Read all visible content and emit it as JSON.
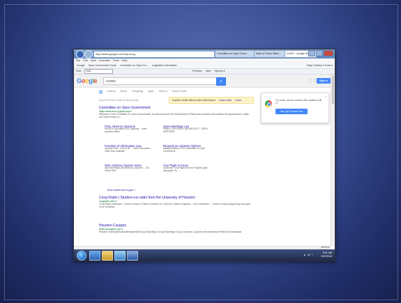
{
  "browser": {
    "address": "http://www.google.com/#q=coog",
    "tabs": [
      "Committee on Open Gove...",
      "State of Texas Office...",
      "COOG - Google Search"
    ],
    "menu": [
      "File",
      "Edit",
      "View",
      "Favorites",
      "Tools",
      "Help"
    ],
    "favorites": [
      "Google",
      "Open Government Guide",
      "Committee on Open Go...",
      "Legislative Information"
    ],
    "command_bar": "Page ▾  Safety ▾  Tools ▾",
    "find_label": "Find:",
    "find_value": "OAG",
    "find_controls": [
      "Previous",
      "Next",
      "Options ▾"
    ]
  },
  "google": {
    "logo": [
      "G",
      "o",
      "o",
      "g",
      "l",
      "e"
    ],
    "query": "COOG",
    "search_icon": "search-icon",
    "signin": "Sign in",
    "tabs": [
      "All",
      "Videos",
      "News",
      "Shopping",
      "Apps",
      "More ▾",
      "Search tools"
    ],
    "result_stats": "About 372,000 results (0.35 seconds)",
    "safesearch": {
      "text": "Explicit results filtered with SafeSearch",
      "learn_more": "Learn more",
      "undo": "Undo"
    },
    "chrome_promo": {
      "text": "Try a fast, secure browser with updates built in.",
      "button": "Yes, get Chrome now"
    }
  },
  "results": [
    {
      "title": "Committee on Open Government",
      "url": "https://www.dos.ny.gov/coog/ ▾",
      "snippet": "Welcome to the Committee on Open Government, as well housed in the Department of State that oversees and advises the government, public, and news media on ..."
    }
  ],
  "sitelinks": [
    {
      "title": "FOIL Advisory Opinions",
      "desc": "SEARCH all posted FOIL Opinions ... draft purpose written"
    },
    {
      "title": "Open Meetings Law",
      "desc": "PUBLIC OFFICERS LAW ARTICLE 7. OPEN MEETINGS"
    },
    {
      "title": "Freedom of Information Law",
      "desc": "January 2015 - 5:30 at 30 ... Panel Discussion - Video Now Available"
    },
    {
      "title": "Request an Advisory Opinion",
      "desc": "Mailing Address: NYS Committee on Open Government"
    },
    {
      "title": "OML Advisory Opinion Index",
      "desc": "Open Meetings Law Advisory Opinions ... OA Select OML"
    },
    {
      "title": "Your Right to Know",
      "desc": "Download \"Your Right to Know\" English (pdf) - descargar \"Su ..."
    }
  ],
  "more_results": "More results from ny.gov »",
  "results2": [
    {
      "title": "Coog Radio | Student-run radio from the University of Houston",
      "url": "coogradio.com ▾",
      "snippet": "Coog Radio Interview – Cohoe Council. Posted on March 10, 2016 by Tolani to Uganda — No Comments ... Cohoe Council stopped by and gave us an amazing ..."
    },
    {
      "title": "Houston Cougars",
      "url": "www.uhcougars.com ▾",
      "snippet": "Practice Schedule/Schedule/Baseball/Group Standings Group Standings Group Coaches Coach/Lomen Beaumont NetDoorn Nebraskal"
    }
  ],
  "status": {
    "zoom": "100% ▾"
  },
  "taskbar": {
    "time": "8:51 AM",
    "date": "3/22/2016",
    "tray": "▲ ◄) ⚐"
  }
}
